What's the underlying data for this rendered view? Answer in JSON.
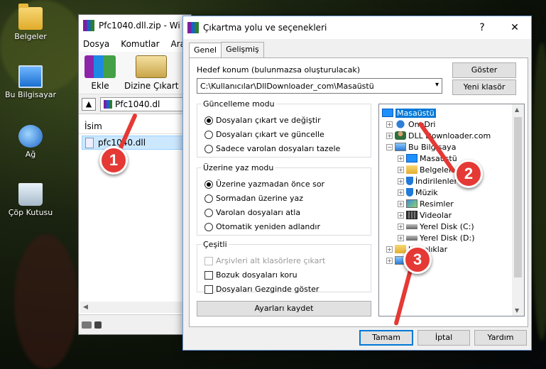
{
  "desktop": {
    "icons": [
      {
        "label": "Belgeler",
        "icon": "folder-icon"
      },
      {
        "label": "Bu Bilgisayar",
        "icon": "computer-icon"
      },
      {
        "label": "Ağ",
        "icon": "network-icon"
      },
      {
        "label": "Çöp Kutusu",
        "icon": "recycle-bin-icon"
      }
    ]
  },
  "winrar": {
    "title": "Pfc1040.dll.zip - Wi",
    "menu": [
      "Dosya",
      "Komutlar",
      "Araçla"
    ],
    "tools": {
      "add": "Ekle",
      "extract": "Dizine Çıkart"
    },
    "path": "Pfc1040.dl",
    "column_name": "İsim",
    "file": "pfc1040.dll"
  },
  "dialog": {
    "title": "Çıkartma yolu ve seçenekleri",
    "help_glyph": "?",
    "close_glyph": "✕",
    "tabs": [
      "Genel",
      "Gelişmiş"
    ],
    "dest_label": "Hedef konum (bulunmazsa oluşturulacak)",
    "dest_value": "C:\\Kullanıcılar\\DllDownloader_com\\Masaüstü",
    "show_button": "Göster",
    "new_folder_button": "Yeni klasör",
    "update_mode": {
      "legend": "Güncelleme modu",
      "options": [
        "Dosyaları çıkart ve değiştir",
        "Dosyaları çıkart ve güncelle",
        "Sadece varolan dosyaları tazele"
      ],
      "selected": 0
    },
    "overwrite_mode": {
      "legend": "Üzerine yaz modu",
      "options": [
        "Üzerine yazmadan önce sor",
        "Sormadan üzerine yaz",
        "Varolan dosyaları atla",
        "Otomatik yeniden adlandır"
      ],
      "selected": 0
    },
    "misc": {
      "legend": "Çeşitli",
      "options": [
        "Arşivleri alt klasörlere çıkart",
        "Bozuk dosyaları koru",
        "Dosyaları Gezginde göster"
      ]
    },
    "save_settings_button": "Ayarları kaydet",
    "tree": [
      {
        "label": "Masaüstü",
        "icon": "desktop-icon",
        "selected": true
      },
      {
        "label": "OneDri",
        "icon": "onedrive-icon"
      },
      {
        "label": "DLL Downloader.com",
        "icon": "user-icon"
      },
      {
        "label": "Bu Bilgisaya",
        "icon": "computer-icon"
      },
      {
        "label": "Masaüstü",
        "icon": "desktop-icon"
      },
      {
        "label": "Belgeler",
        "icon": "folder-icon"
      },
      {
        "label": "İndirilenler",
        "icon": "download-icon"
      },
      {
        "label": "Müzik",
        "icon": "music-icon"
      },
      {
        "label": "Resimler",
        "icon": "pictures-icon"
      },
      {
        "label": "Videolar",
        "icon": "videos-icon"
      },
      {
        "label": "Yerel Disk (C:)",
        "icon": "disk-icon"
      },
      {
        "label": "Yerel Disk (D:)",
        "icon": "disk-icon"
      },
      {
        "label": "Kitaplıklar",
        "icon": "folder-icon"
      }
    ],
    "ok_button": "Tamam",
    "cancel_button": "İptal",
    "help_button": "Yardım"
  },
  "annotations": [
    "1",
    "2",
    "3"
  ],
  "colors": {
    "annotation": "#e53935",
    "selection": "#0078d7"
  }
}
